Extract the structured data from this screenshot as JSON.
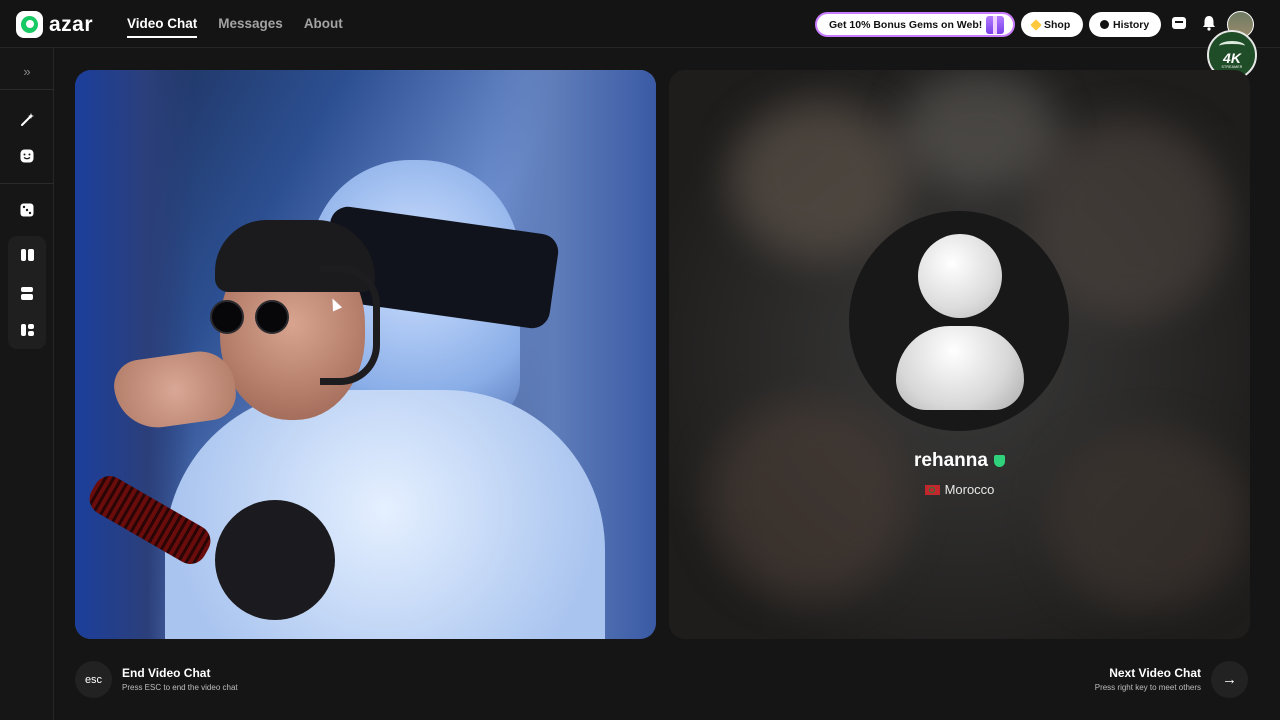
{
  "app": {
    "logo_text": "azar"
  },
  "nav": {
    "items": [
      {
        "label": "Video Chat",
        "active": true
      },
      {
        "label": "Messages",
        "active": false
      },
      {
        "label": "About",
        "active": false
      }
    ]
  },
  "header": {
    "promo_label": "Get 10% Bonus Gems on Web!",
    "shop_label": "Shop",
    "history_label": "History",
    "badge": {
      "main": "4K",
      "sub": "STREAMER"
    }
  },
  "sidebar": {
    "icons": [
      "expand-icon",
      "magic-wand-icon",
      "face-icon",
      "dice-icon",
      "layout-split-vertical-icon",
      "layout-split-horizontal-icon",
      "layout-mosaic-icon"
    ]
  },
  "peer": {
    "name": "rehanna",
    "country": "Morocco",
    "flag": "morocco-flag-icon"
  },
  "actions": {
    "esc_key": "esc",
    "end_title": "End Video Chat",
    "end_sub": "Press ESC to end the video chat",
    "next_title": "Next Video Chat",
    "next_sub": "Press right key to meet others",
    "next_icon": "→"
  },
  "colors": {
    "accent": "#18c964",
    "promo_border": "#c87cff",
    "background": "#151515"
  }
}
